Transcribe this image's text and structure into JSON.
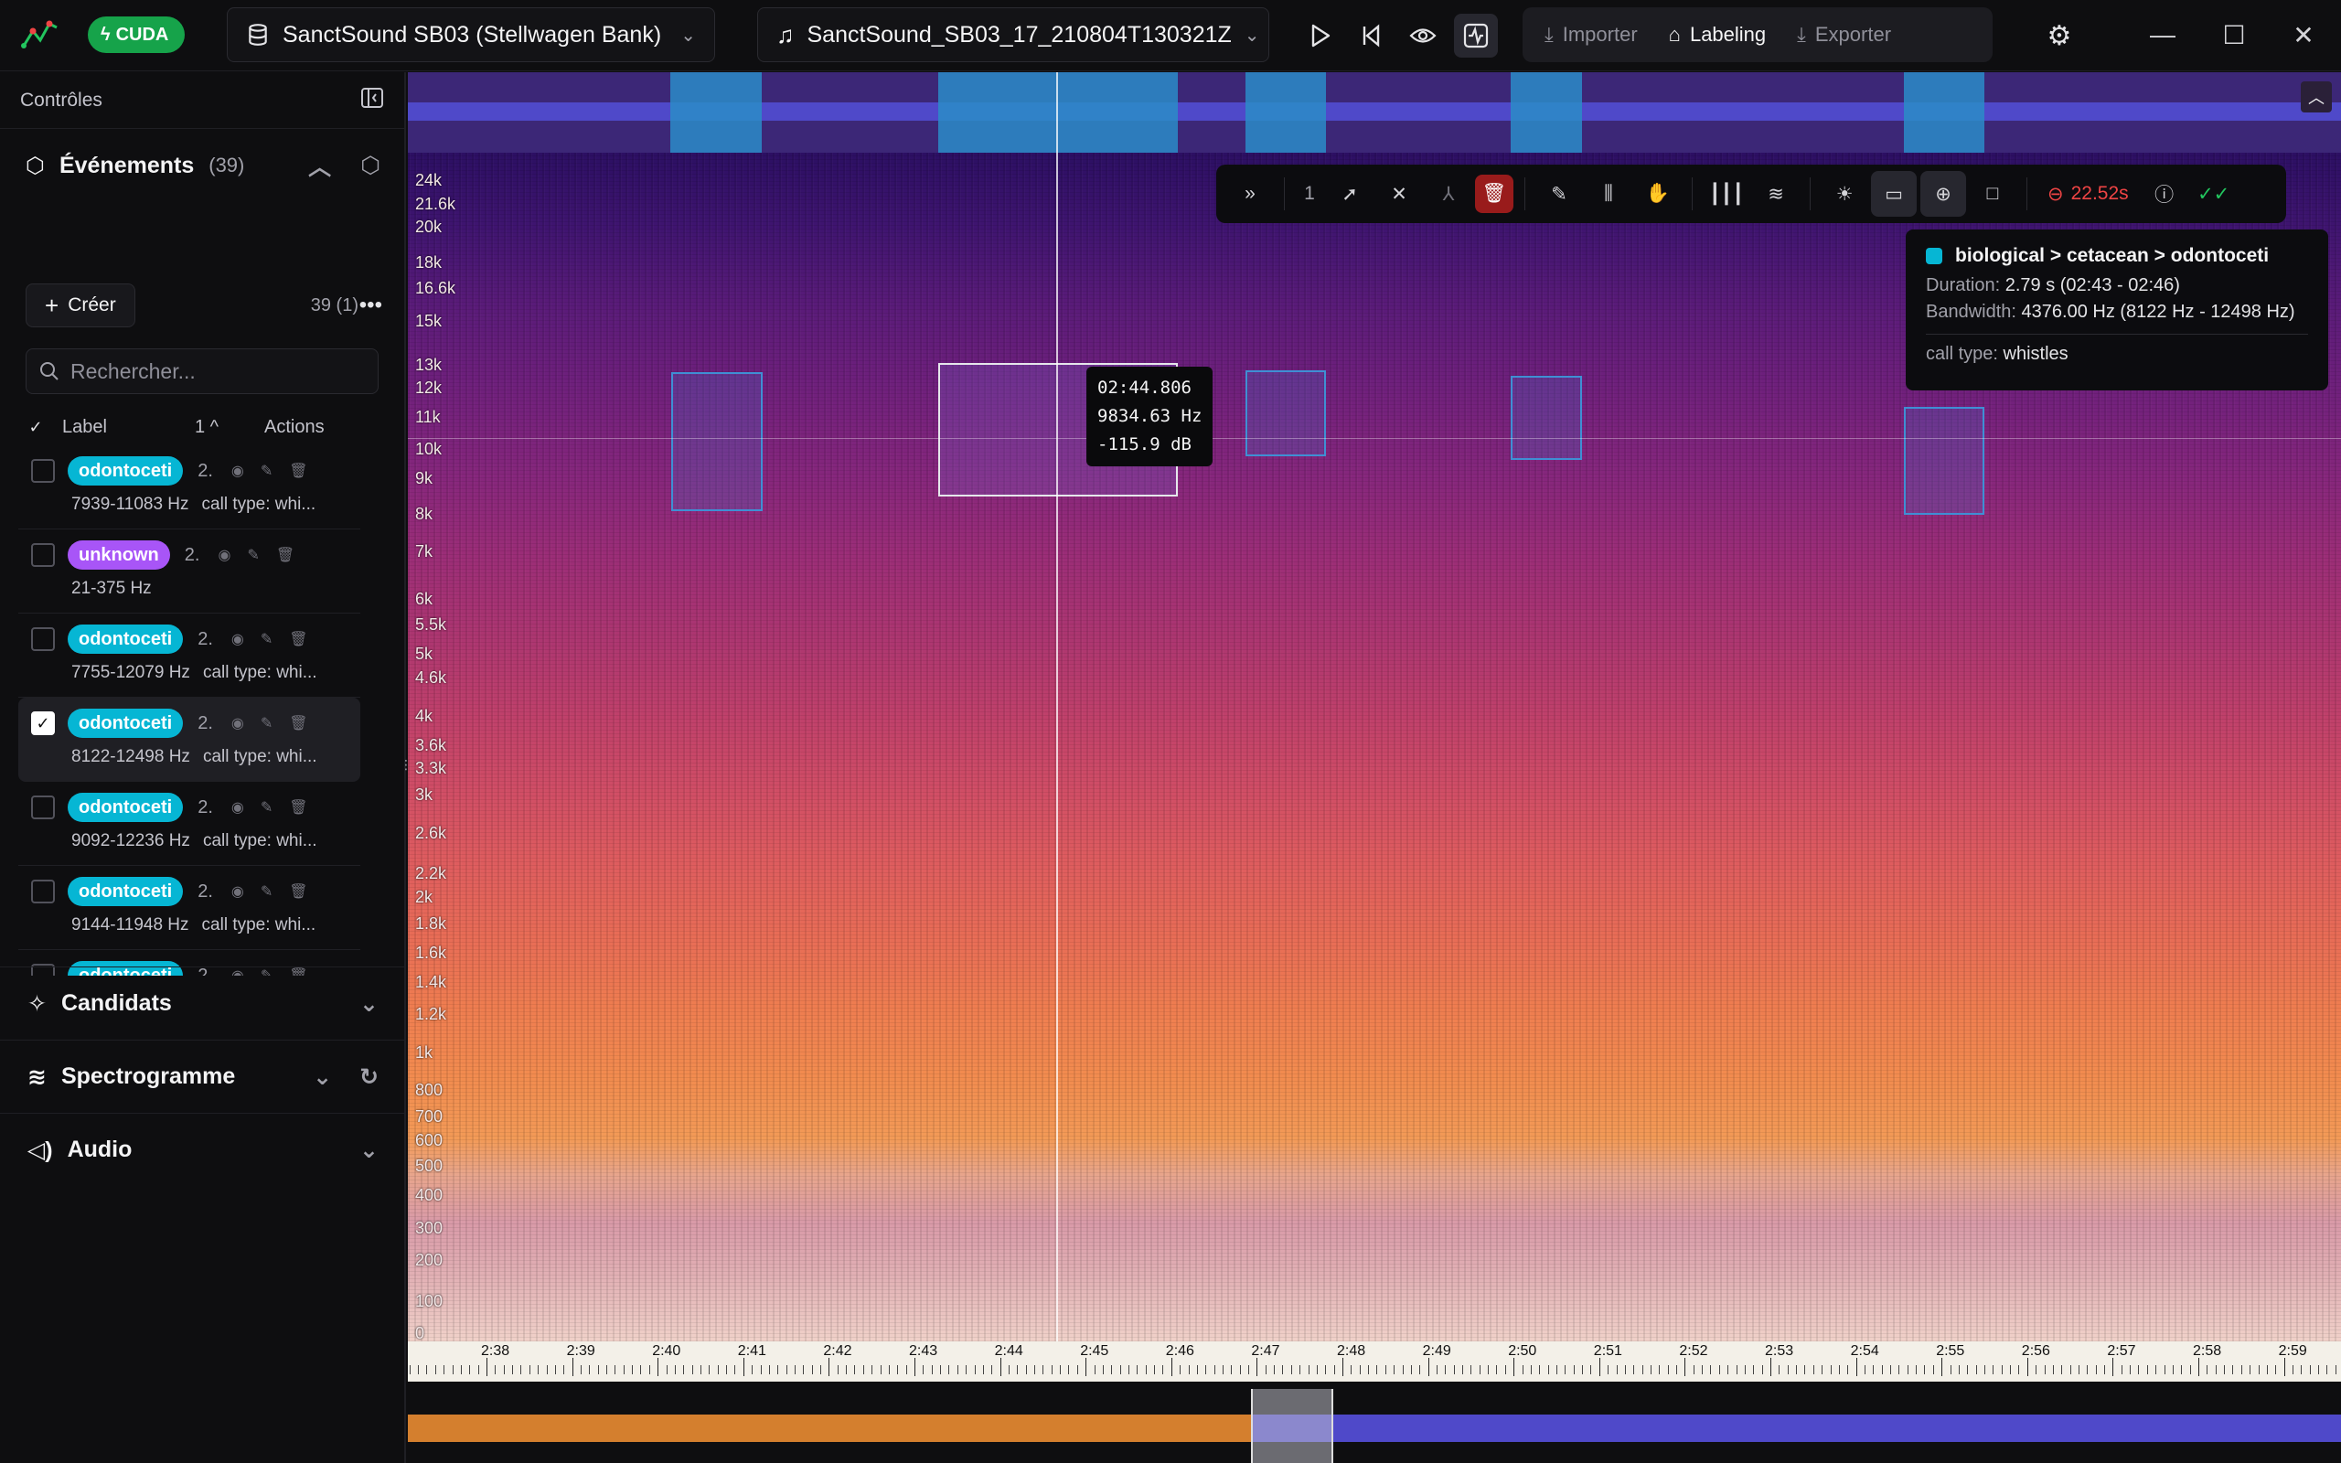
{
  "topbar": {
    "cuda_label": "CUDA",
    "project": "SanctSound SB03 (Stellwagen Bank)",
    "file": "SanctSound_SB03_17_210804T130321Z",
    "tabs": [
      "Importer",
      "Labeling",
      "Exporter"
    ],
    "active_tab": "Labeling"
  },
  "sidebar": {
    "header": "Contrôles",
    "events": {
      "title": "Événements",
      "count": "(39)",
      "create_label": "Créer",
      "selection_count": "39 (1)",
      "search_placeholder": "Rechercher...",
      "col_label": "Label",
      "col_sort": "1",
      "col_actions": "Actions",
      "items": [
        {
          "label": "odontoceti",
          "color": "#06b6d4",
          "num": "2.",
          "range": "7939-11083 Hz",
          "desc": "call type: whi...",
          "checked": false
        },
        {
          "label": "unknown",
          "color": "#a855f7",
          "num": "2.",
          "range": "21-375 Hz",
          "desc": "",
          "checked": false
        },
        {
          "label": "odontoceti",
          "color": "#06b6d4",
          "num": "2.",
          "range": "7755-12079 Hz",
          "desc": "call type: whi...",
          "checked": false
        },
        {
          "label": "odontoceti",
          "color": "#06b6d4",
          "num": "2.",
          "range": "8122-12498 Hz",
          "desc": "call type: whi...",
          "checked": true
        },
        {
          "label": "odontoceti",
          "color": "#06b6d4",
          "num": "2.",
          "range": "9092-12236 Hz",
          "desc": "call type: whi...",
          "checked": false
        },
        {
          "label": "odontoceti",
          "color": "#06b6d4",
          "num": "2.",
          "range": "9144-11948 Hz",
          "desc": "call type: whi...",
          "checked": false
        },
        {
          "label": "odontoceti",
          "color": "#06b6d4",
          "num": "2.",
          "range": "",
          "desc": "",
          "checked": false
        }
      ]
    },
    "sections": {
      "candidates": "Candidats",
      "spectrogram": "Spectrogramme",
      "audio": "Audio"
    }
  },
  "spectrogram": {
    "y_ticks": [
      "24k",
      "21.6k",
      "20k",
      "18k",
      "16.6k",
      "15k",
      "13k",
      "12k",
      "11k",
      "10k",
      "9k",
      "8k",
      "7k",
      "6k",
      "5.5k",
      "5k",
      "4.6k",
      "4k",
      "3.6k",
      "3.3k",
      "3k",
      "2.6k",
      "2.2k",
      "2k",
      "1.8k",
      "1.6k",
      "1.4k",
      "1.2k",
      "1k",
      "800",
      "700",
      "600",
      "500",
      "400",
      "300",
      "200",
      "100",
      "0"
    ],
    "readout": {
      "time": "02:44.806",
      "freq": "9834.63 Hz",
      "level": "-115.9 dB"
    },
    "toolbar": {
      "count": "1",
      "zoom": "22.52s"
    },
    "tooltip": {
      "title": "biological > cetacean > odontoceti",
      "duration_label": "Duration:",
      "duration": "2.79 s (02:43 - 02:46)",
      "bandwidth_label": "Bandwidth:",
      "bandwidth": "4376.00 Hz (8122 Hz - 12498 Hz)",
      "calltype_label": "call type:",
      "calltype": "whistles"
    },
    "time_labels": [
      "2:38",
      "2:39",
      "2:40",
      "2:41",
      "2:42",
      "2:43",
      "2:44",
      "2:45",
      "2:46",
      "2:47",
      "2:48",
      "2:49",
      "2:50",
      "2:51",
      "2:52",
      "2:53",
      "2:54",
      "2:55",
      "2:56",
      "2:57",
      "2:58",
      "2:59"
    ]
  }
}
